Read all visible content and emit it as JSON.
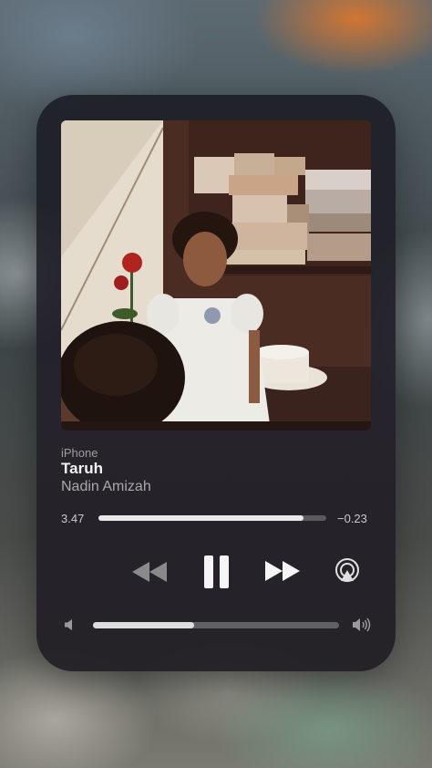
{
  "now_playing": {
    "source": "iPhone",
    "title": "Taruh",
    "artist": "Nadin Amizah",
    "elapsed": "3.47",
    "remaining": "−0.23",
    "progress_fraction": 0.9,
    "volume_fraction": 0.41
  },
  "controls": {
    "rewind_icon": "rewind-icon",
    "pause_icon": "pause-icon",
    "forward_icon": "fast-forward-icon",
    "airplay_icon": "airplay-audio-icon",
    "volume_low_icon": "speaker-low-icon",
    "volume_high_icon": "speaker-high-icon"
  },
  "colors": {
    "primary_text": "#f2f2f2",
    "rewind_dimmed": "#8a8a8a"
  }
}
